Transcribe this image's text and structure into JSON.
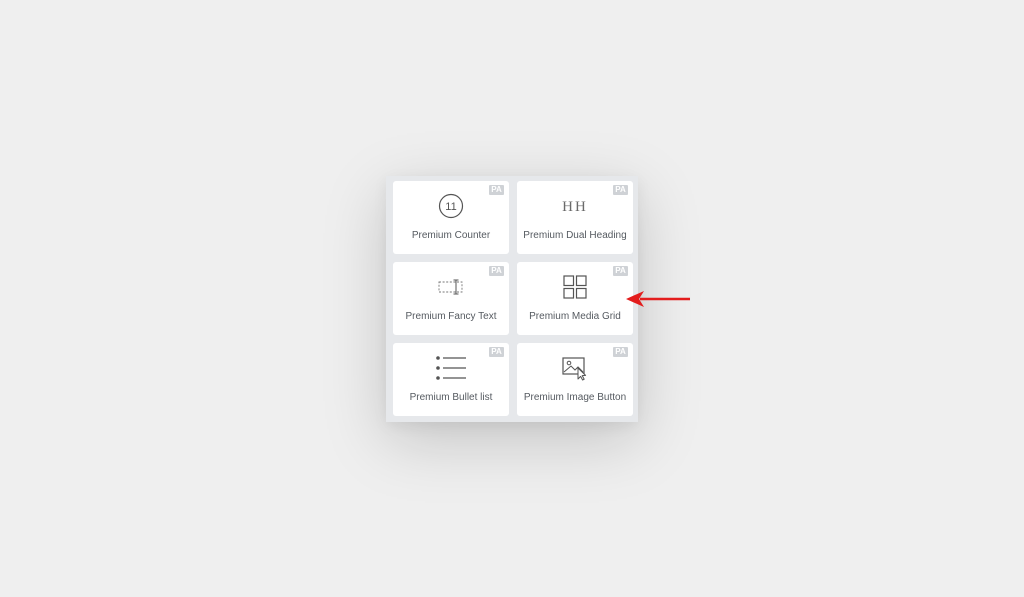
{
  "widgets": [
    {
      "label": "Premium Counter",
      "badge": "PA",
      "icon": "counter-icon",
      "icon_text": "11"
    },
    {
      "label": "Premium Dual Heading",
      "badge": "PA",
      "icon": "dual-heading-icon",
      "icon_text": "HH"
    },
    {
      "label": "Premium Fancy Text",
      "badge": "PA",
      "icon": "fancy-text-icon"
    },
    {
      "label": "Premium Media Grid",
      "badge": "PA",
      "icon": "media-grid-icon"
    },
    {
      "label": "Premium Bullet list",
      "badge": "PA",
      "icon": "bullet-list-icon"
    },
    {
      "label": "Premium Image Button",
      "badge": "PA",
      "icon": "image-button-icon"
    }
  ],
  "annotation": {
    "icon": "red-arrow-icon",
    "color": "#e31d1d"
  },
  "colors": {
    "background": "#efefef",
    "panel": "#e6e8eb",
    "tile": "#ffffff",
    "badge": "#cfd2d6",
    "icon": "#545454",
    "label": "#555a60"
  }
}
